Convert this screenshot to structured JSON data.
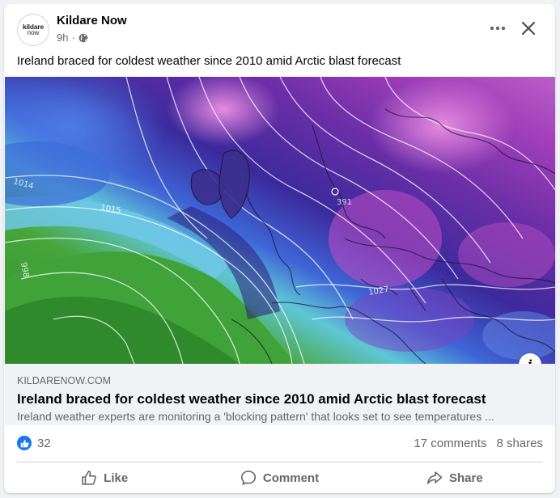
{
  "post": {
    "page_name": "Kildare Now",
    "avatar_line1": "kildare",
    "avatar_line2": "now",
    "time": "9h",
    "meta_separator": "·",
    "privacy_icon": "globe-icon",
    "text": "Ireland braced for coldest weather since 2010 amid Arctic blast forecast"
  },
  "image": {
    "map_labels": [
      "1014",
      "1015",
      "998",
      "1027",
      "391"
    ],
    "info_label": "i"
  },
  "link": {
    "domain": "KILDARENOW.COM",
    "title": "Ireland braced for coldest weather since 2010 amid Arctic blast forecast",
    "description": "Ireland weather experts are monitoring a 'blocking pattern' that looks set to see temperatures ..."
  },
  "stats": {
    "reaction_icon": "like-icon",
    "reaction_count": "32",
    "comments": "17 comments",
    "shares": "8 shares"
  },
  "actions": {
    "like": "Like",
    "comment": "Comment",
    "share": "Share"
  },
  "colors": {
    "accent": "#1877f2",
    "secondary_text": "#65676b",
    "link_bg": "#f0f2f5"
  }
}
